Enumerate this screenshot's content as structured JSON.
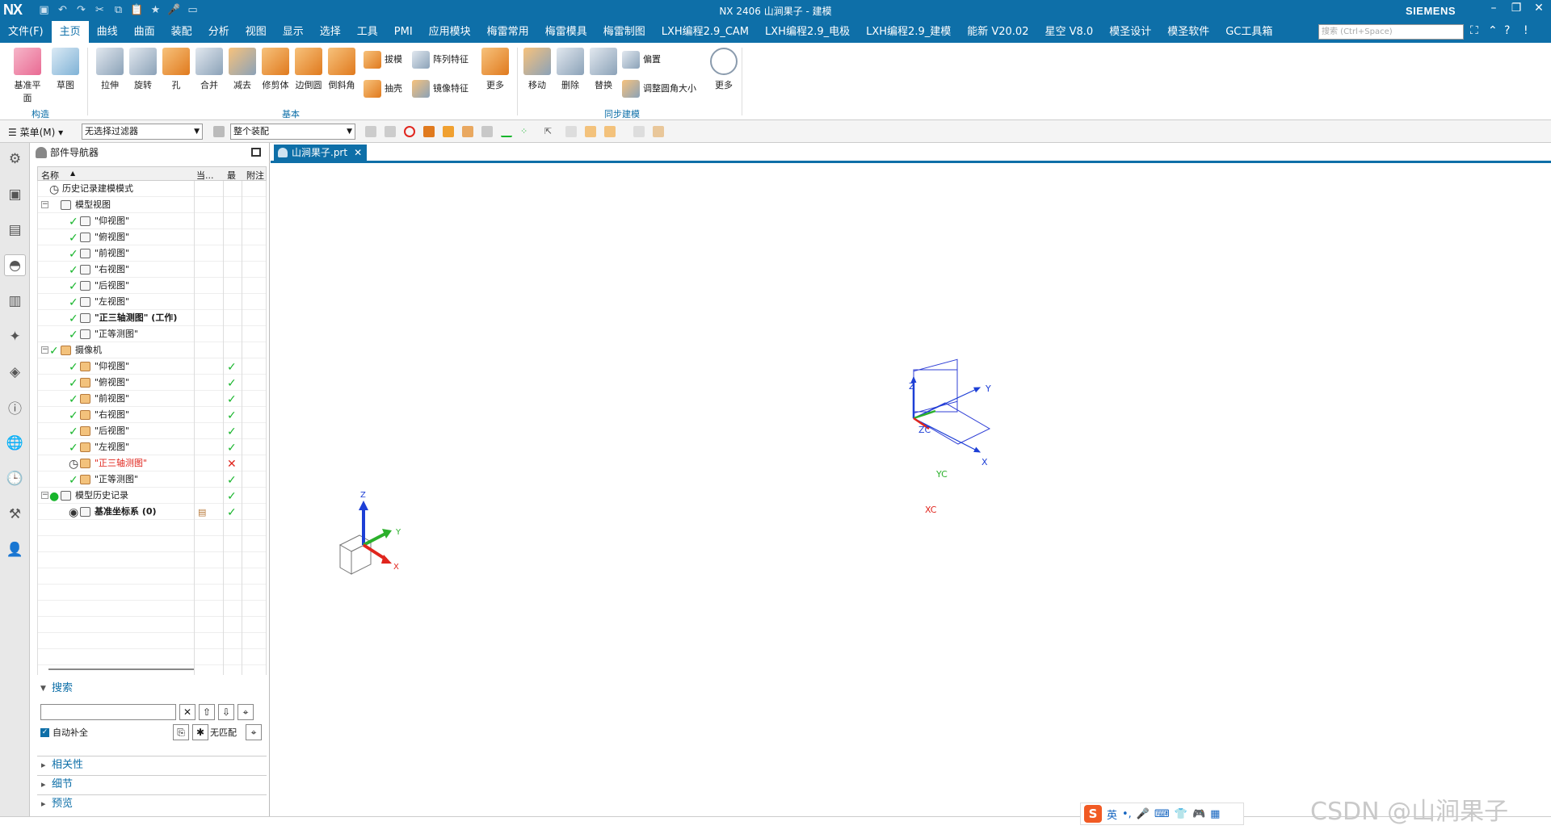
{
  "window": {
    "app_logo": "NX",
    "title": "NX 2406 山涧果子 - 建模",
    "brand": "SIEMENS"
  },
  "menu": {
    "file": "文件(F)",
    "items": [
      "主页",
      "曲线",
      "曲面",
      "装配",
      "分析",
      "视图",
      "显示",
      "选择",
      "工具",
      "PMI",
      "应用模块",
      "梅雷常用",
      "梅雷模具",
      "梅雷制图",
      "LXH编程2.9_CAM",
      "LXH编程2.9_电极",
      "LXH编程2.9_建模",
      "能新 V20.02",
      "星空 V8.0",
      "模圣设计",
      "模圣软件",
      "GC工具箱"
    ],
    "active": "主页",
    "search_placeholder": "搜索 (Ctrl+Space)"
  },
  "ribbon": {
    "construct": {
      "datum_plane": "基准平面",
      "sketch": "草图",
      "label": "构造"
    },
    "basic": {
      "extrude": "拉伸",
      "revolve": "旋转",
      "hole": "孔",
      "unite": "合并",
      "subtract": "减去",
      "trim_body": "修剪体",
      "edge_blend": "边倒圆",
      "chamfer": "倒斜角",
      "draft": "拔模",
      "shell": "抽壳",
      "pattern_feature": "阵列特征",
      "mirror_feature": "镜像特征",
      "more": "更多",
      "label": "基本"
    },
    "sync": {
      "move": "移动",
      "delete": "删除",
      "replace": "替换",
      "offset": "偏置",
      "resize_blend": "调整圆角大小",
      "more": "更多",
      "label": "同步建模"
    }
  },
  "selbar": {
    "menu": "菜单(M)",
    "filter": "无选择过滤器",
    "scope": "整个装配"
  },
  "navigator": {
    "title": "部件导航器",
    "columns": {
      "name": "名称",
      "current": "当...",
      "latest": "最",
      "note": "附注"
    },
    "rows": [
      {
        "label": "历史记录建模模式"
      },
      {
        "label": "模型视图"
      },
      {
        "label": "\"仰视图\""
      },
      {
        "label": "\"俯视图\""
      },
      {
        "label": "\"前视图\""
      },
      {
        "label": "\"右视图\""
      },
      {
        "label": "\"后视图\""
      },
      {
        "label": "\"左视图\""
      },
      {
        "label": "\"正三轴测图\" (工作)"
      },
      {
        "label": "\"正等测图\""
      },
      {
        "label": "摄像机"
      },
      {
        "label": "\"仰视图\""
      },
      {
        "label": "\"俯视图\""
      },
      {
        "label": "\"前视图\""
      },
      {
        "label": "\"右视图\""
      },
      {
        "label": "\"后视图\""
      },
      {
        "label": "\"左视图\""
      },
      {
        "label": "\"正三轴测图\""
      },
      {
        "label": "\"正等测图\""
      },
      {
        "label": "模型历史记录"
      },
      {
        "label": "基准坐标系 (0)"
      }
    ]
  },
  "search": {
    "title": "搜索",
    "auto_complete": "自动补全",
    "no_match": "无匹配",
    "sections": [
      "相关性",
      "细节",
      "预览"
    ]
  },
  "doc_tab": {
    "label": "山涧果子.prt"
  },
  "axes": {
    "z": "Z",
    "y": "Y",
    "x": "X",
    "zc": "ZC",
    "yc": "YC",
    "xc": "XC"
  },
  "ime": {
    "lang": "英"
  },
  "watermark": "CSDN @山涧果子"
}
